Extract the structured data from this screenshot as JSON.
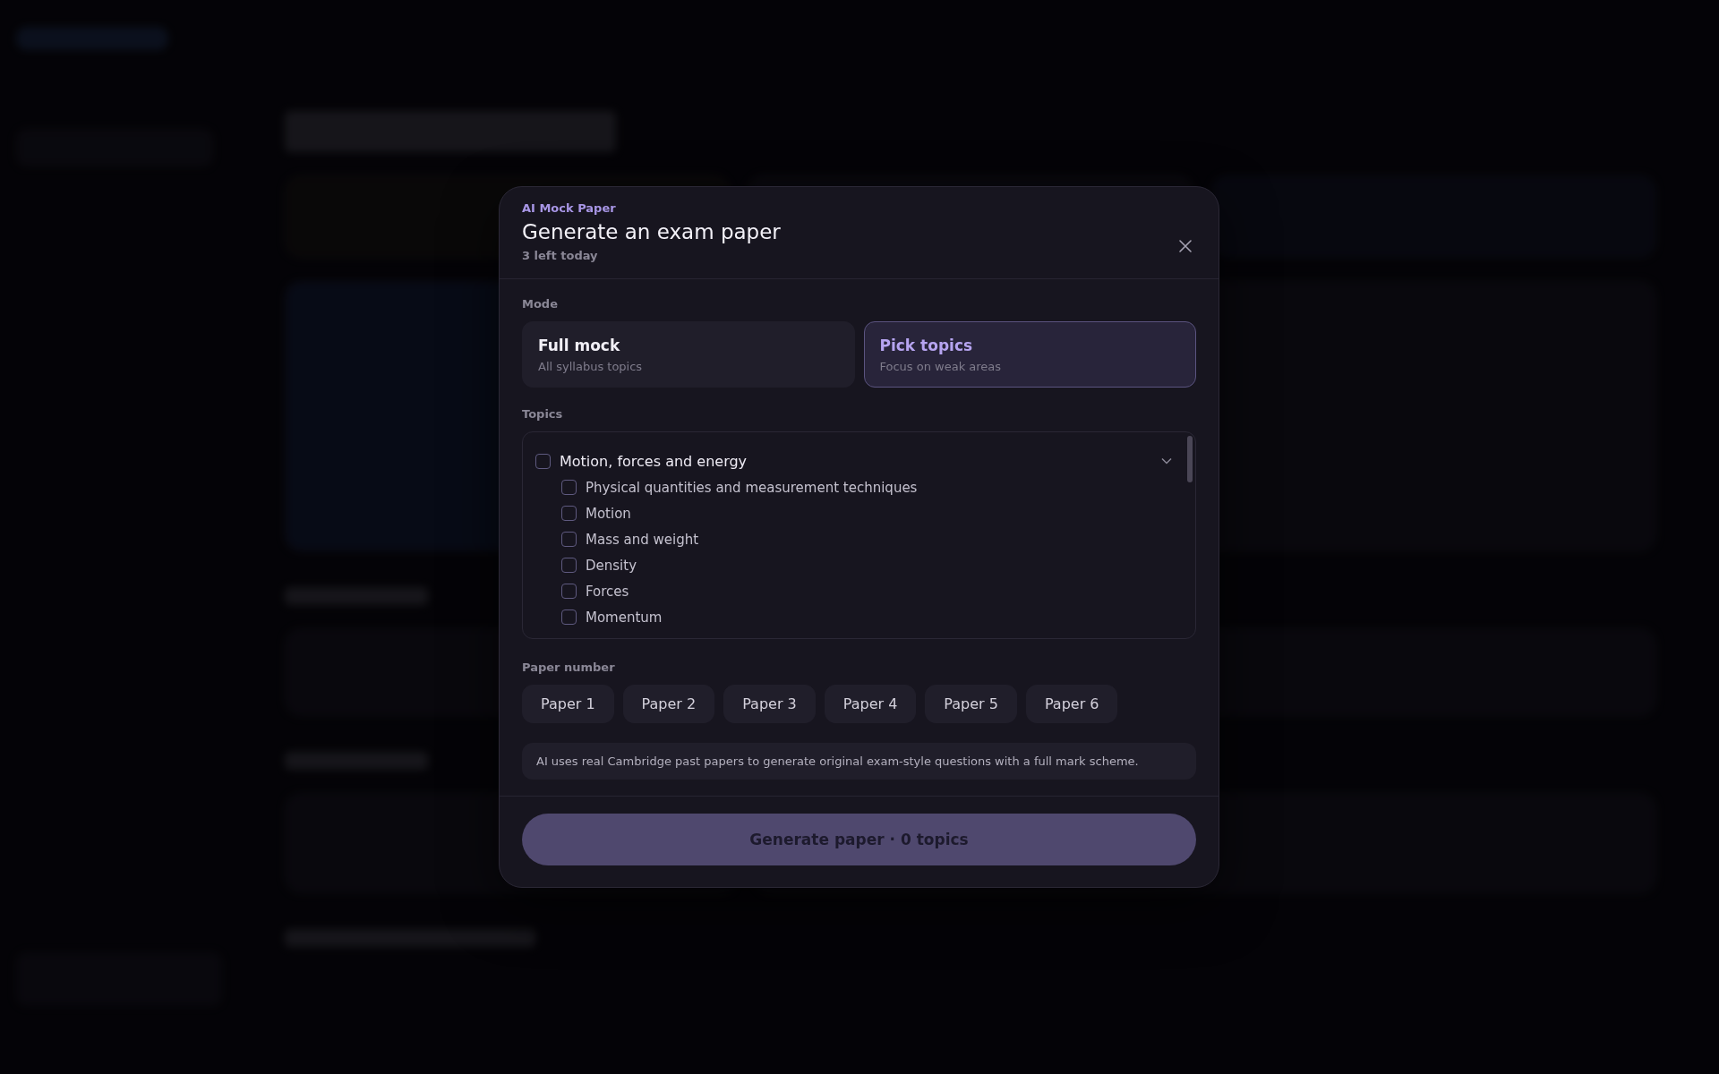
{
  "dialog": {
    "eyebrow": "AI Mock Paper",
    "title": "Generate an exam paper",
    "subtitle": "3 left today",
    "mode_label": "Mode",
    "modes": [
      {
        "title": "Full mock",
        "description": "All syllabus topics",
        "selected": false
      },
      {
        "title": "Pick topics",
        "description": "Focus on weak areas",
        "selected": true
      }
    ],
    "topics_label": "Topics",
    "topic_groups": [
      {
        "label": "Motion, forces and energy",
        "checked": false,
        "expanded": true,
        "children": [
          {
            "label": "Physical quantities and measurement techniques",
            "checked": false
          },
          {
            "label": "Motion",
            "checked": false
          },
          {
            "label": "Mass and weight",
            "checked": false
          },
          {
            "label": "Density",
            "checked": false
          },
          {
            "label": "Forces",
            "checked": false
          },
          {
            "label": "Momentum",
            "checked": false
          }
        ]
      }
    ],
    "paper_label": "Paper number",
    "papers": [
      {
        "label": "Paper 1",
        "selected": false
      },
      {
        "label": "Paper 2",
        "selected": false
      },
      {
        "label": "Paper 3",
        "selected": false
      },
      {
        "label": "Paper 4",
        "selected": false
      },
      {
        "label": "Paper 5",
        "selected": false
      },
      {
        "label": "Paper 6",
        "selected": false
      }
    ],
    "note": "AI uses real Cambridge past papers to generate original exam-style questions with a full mark scheme.",
    "generate_button": "Generate paper · 0 topics"
  }
}
